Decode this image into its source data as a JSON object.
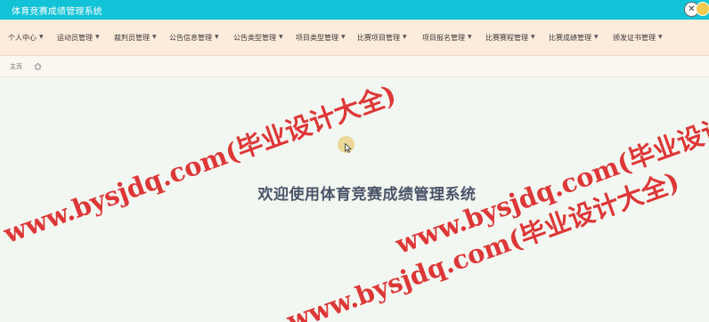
{
  "app": {
    "title": "体育竞赛成绩管理系统"
  },
  "topbar_icons": {
    "close": "close-icon",
    "avatar": "avatar-icon"
  },
  "nav": {
    "items": [
      {
        "label": "个人中心"
      },
      {
        "label": "运动员管理"
      },
      {
        "label": "裁判员管理"
      },
      {
        "label": "公告信息管理"
      },
      {
        "label": "公告类型管理"
      },
      {
        "label": "项目类型管理"
      },
      {
        "label": "比赛项目管理"
      },
      {
        "label": "项目报名管理"
      },
      {
        "label": "比赛赛程管理"
      },
      {
        "label": "比赛成绩管理"
      },
      {
        "label": "颁发证书管理"
      }
    ]
  },
  "breadcrumb": {
    "home": "主页",
    "icon": "home-icon"
  },
  "main": {
    "welcome": "欢迎使用体育竞赛成绩管理系统"
  },
  "watermark": {
    "text": "www.bysjdq.com(毕业设计大全)"
  },
  "colors": {
    "topbar": "#12c2d6",
    "navbar": "#fdebdc",
    "background": "#f3f7f1",
    "welcome_text": "#4a5468",
    "watermark": "#da2626"
  }
}
